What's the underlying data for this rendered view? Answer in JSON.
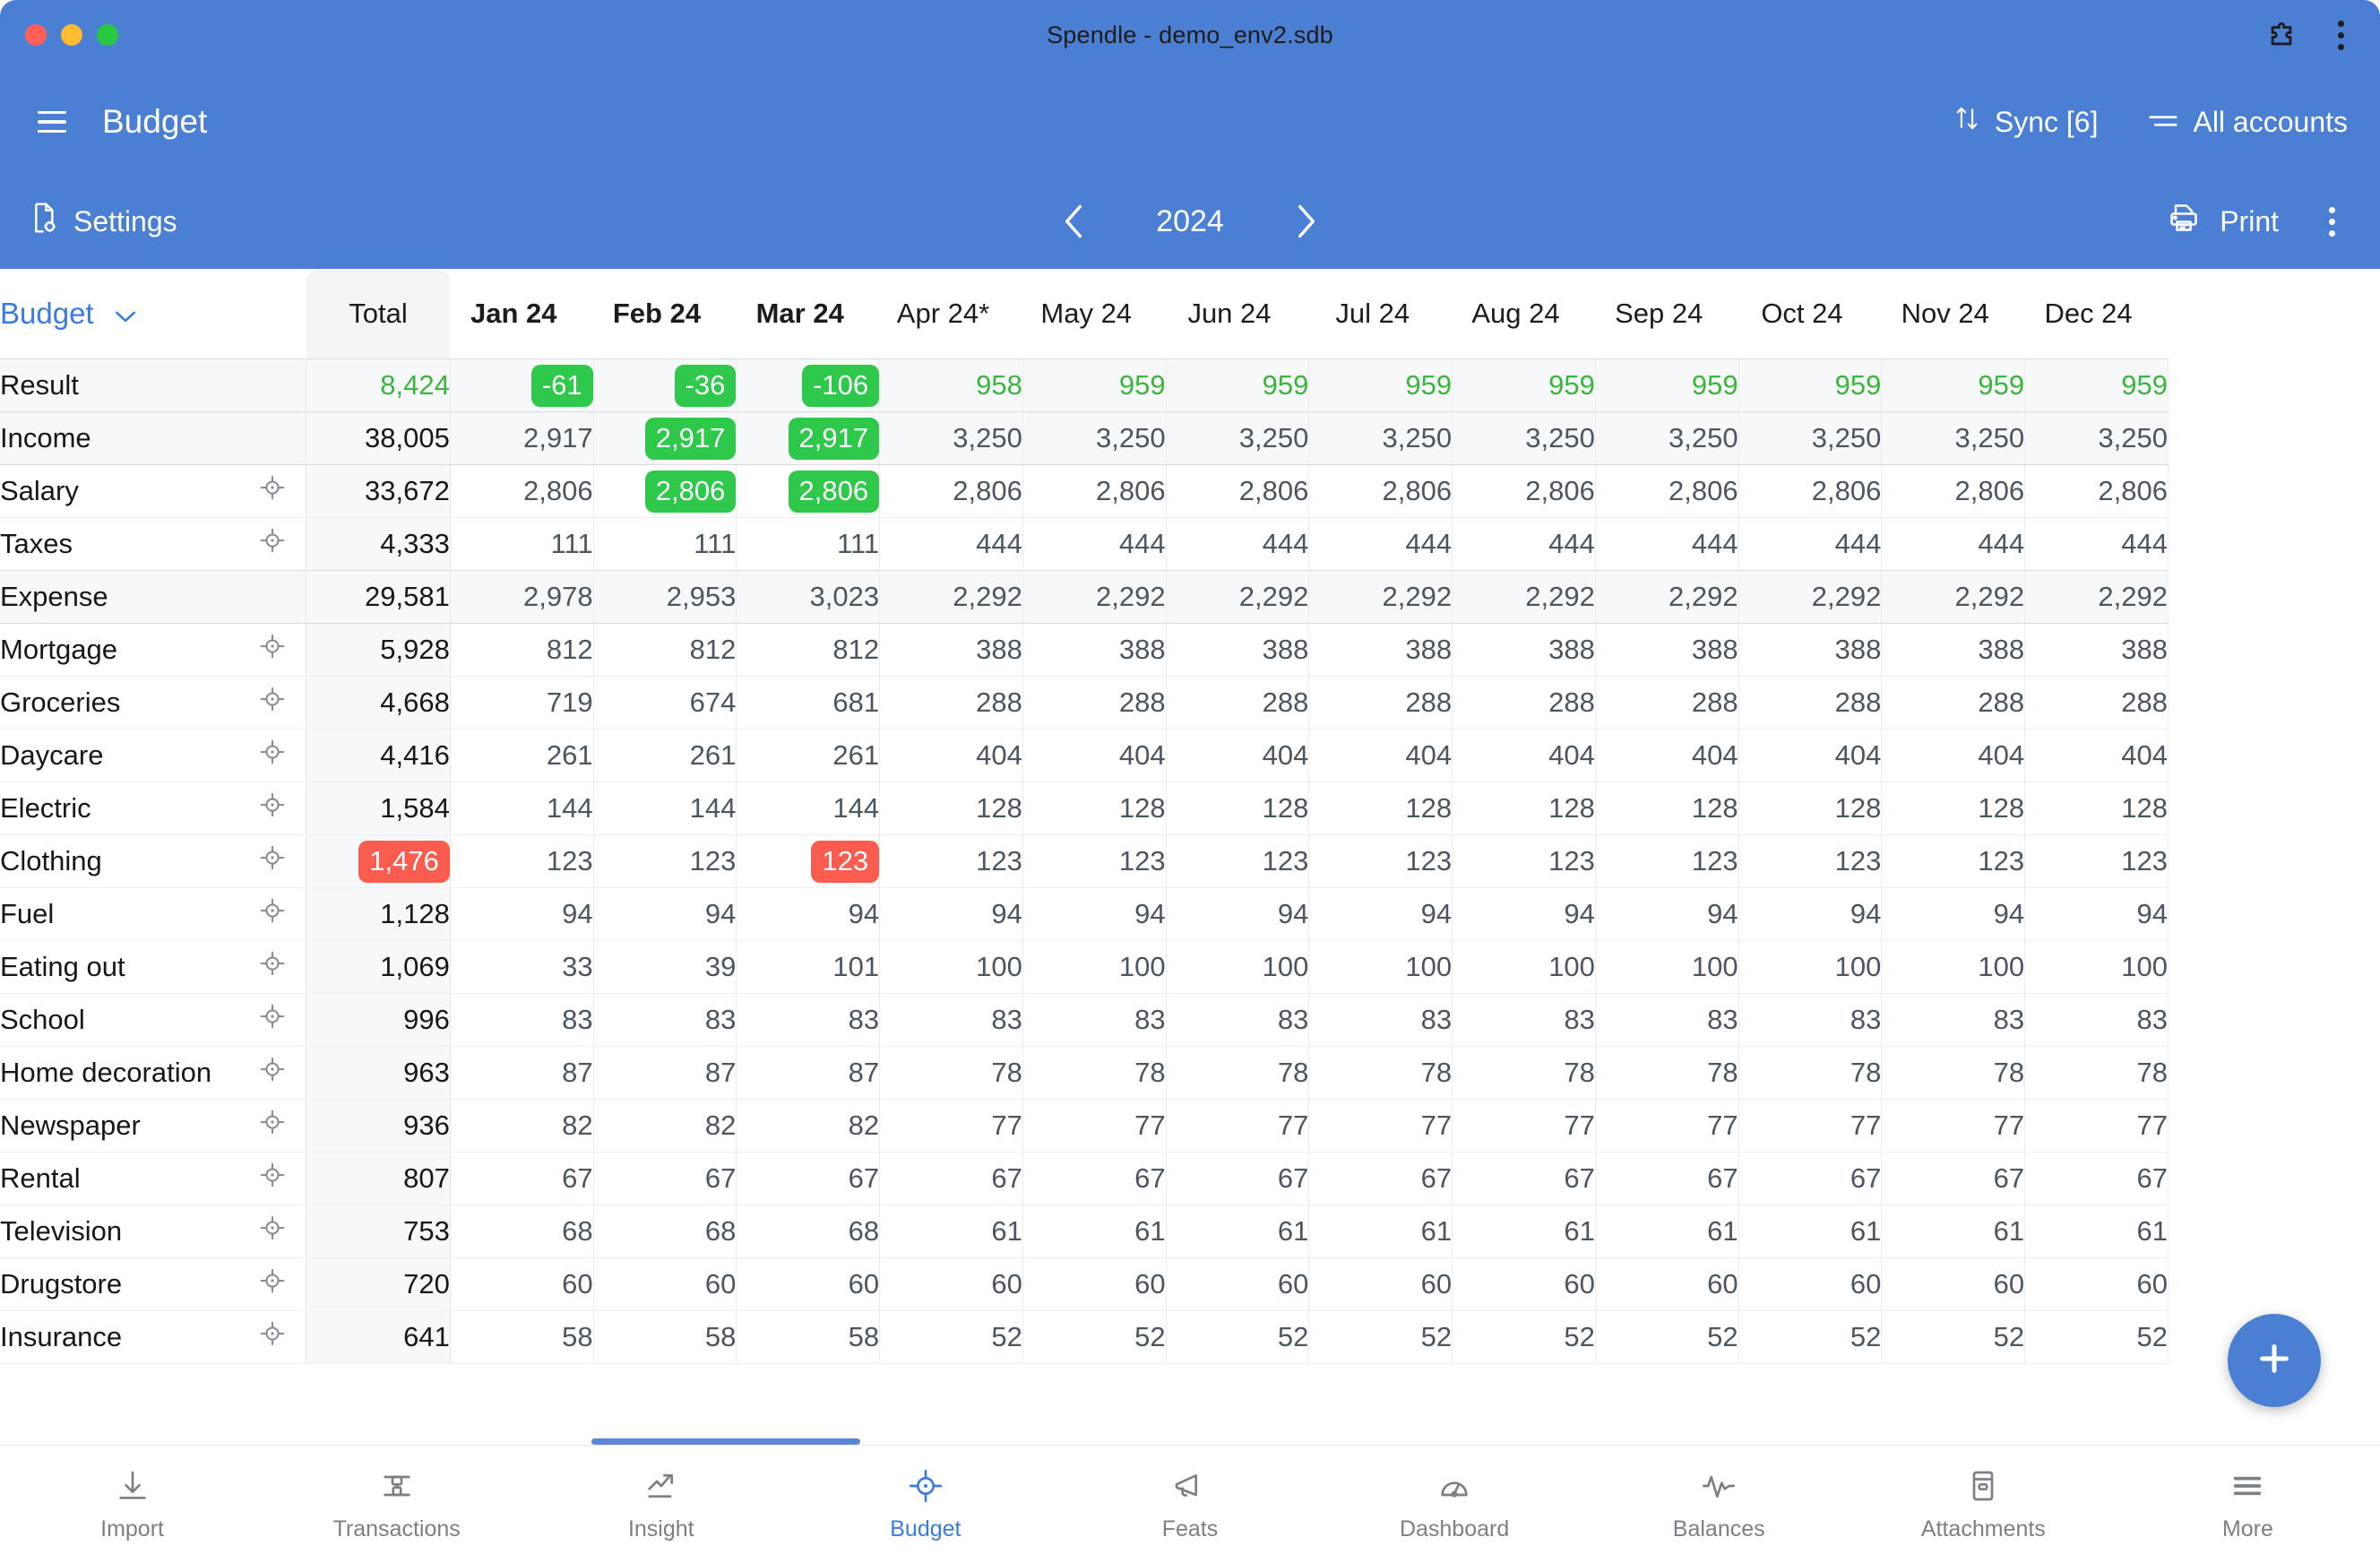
{
  "window": {
    "title": "Spendle - demo_env2.sdb",
    "traffic_lights": [
      "close",
      "minimize",
      "maximize"
    ],
    "extension_icon": "puzzle-piece-icon",
    "overflow_icon": "three-dot-menu-icon"
  },
  "navbar": {
    "menu_icon": "hamburger-icon",
    "title": "Budget",
    "sync_label": "Sync [6]",
    "sync_icon": "sync-arrows-icon",
    "accounts_label": "All accounts",
    "accounts_icon": "filter-list-icon"
  },
  "subbar": {
    "settings_label": "Settings",
    "settings_icon": "document-gear-icon",
    "prev_icon": "chevron-left-icon",
    "year": "2024",
    "next_icon": "chevron-right-icon",
    "print_label": "Print",
    "print_icon": "printer-icon",
    "more_icon": "three-dot-menu-icon"
  },
  "table": {
    "view_selector": "Budget",
    "view_selector_icon": "chevron-down-icon",
    "total_header": "Total",
    "months": [
      {
        "label": "Jan 24",
        "bold": true
      },
      {
        "label": "Feb 24",
        "bold": true
      },
      {
        "label": "Mar 24",
        "bold": true
      },
      {
        "label": "Apr 24*",
        "bold": false
      },
      {
        "label": "May 24",
        "bold": false
      },
      {
        "label": "Jun 24",
        "bold": false
      },
      {
        "label": "Jul 24",
        "bold": false
      },
      {
        "label": "Aug 24",
        "bold": false
      },
      {
        "label": "Sep 24",
        "bold": false
      },
      {
        "label": "Oct 24",
        "bold": false
      },
      {
        "label": "Nov 24",
        "bold": false
      },
      {
        "label": "Dec 24",
        "bold": false
      }
    ],
    "rows": [
      {
        "label": "Result",
        "type": "summary",
        "accent": "green",
        "target_icon": false,
        "total": "8,424",
        "cells": [
          {
            "v": "-61",
            "badge": "green"
          },
          {
            "v": "-36",
            "badge": "green"
          },
          {
            "v": "-106",
            "badge": "green"
          },
          {
            "v": "958"
          },
          {
            "v": "959"
          },
          {
            "v": "959"
          },
          {
            "v": "959"
          },
          {
            "v": "959"
          },
          {
            "v": "959"
          },
          {
            "v": "959"
          },
          {
            "v": "959"
          },
          {
            "v": "959"
          }
        ]
      },
      {
        "label": "Income",
        "type": "summary",
        "target_icon": false,
        "total": "38,005",
        "cells": [
          {
            "v": "2,917"
          },
          {
            "v": "2,917",
            "badge": "green"
          },
          {
            "v": "2,917",
            "badge": "green"
          },
          {
            "v": "3,250"
          },
          {
            "v": "3,250"
          },
          {
            "v": "3,250"
          },
          {
            "v": "3,250"
          },
          {
            "v": "3,250"
          },
          {
            "v": "3,250"
          },
          {
            "v": "3,250"
          },
          {
            "v": "3,250"
          },
          {
            "v": "3,250"
          }
        ]
      },
      {
        "label": "Salary",
        "type": "item",
        "target_icon": true,
        "total": "33,672",
        "cells": [
          {
            "v": "2,806"
          },
          {
            "v": "2,806",
            "badge": "green"
          },
          {
            "v": "2,806",
            "badge": "green"
          },
          {
            "v": "2,806"
          },
          {
            "v": "2,806"
          },
          {
            "v": "2,806"
          },
          {
            "v": "2,806"
          },
          {
            "v": "2,806"
          },
          {
            "v": "2,806"
          },
          {
            "v": "2,806"
          },
          {
            "v": "2,806"
          },
          {
            "v": "2,806"
          }
        ]
      },
      {
        "label": "Taxes",
        "type": "item",
        "target_icon": true,
        "total": "4,333",
        "cells": [
          {
            "v": "111"
          },
          {
            "v": "111"
          },
          {
            "v": "111"
          },
          {
            "v": "444"
          },
          {
            "v": "444"
          },
          {
            "v": "444"
          },
          {
            "v": "444"
          },
          {
            "v": "444"
          },
          {
            "v": "444"
          },
          {
            "v": "444"
          },
          {
            "v": "444"
          },
          {
            "v": "444"
          }
        ]
      },
      {
        "label": "Expense",
        "type": "summary",
        "target_icon": false,
        "total": "29,581",
        "cells": [
          {
            "v": "2,978"
          },
          {
            "v": "2,953"
          },
          {
            "v": "3,023"
          },
          {
            "v": "2,292"
          },
          {
            "v": "2,292"
          },
          {
            "v": "2,292"
          },
          {
            "v": "2,292"
          },
          {
            "v": "2,292"
          },
          {
            "v": "2,292"
          },
          {
            "v": "2,292"
          },
          {
            "v": "2,292"
          },
          {
            "v": "2,292"
          }
        ]
      },
      {
        "label": "Mortgage",
        "type": "item",
        "target_icon": true,
        "total": "5,928",
        "cells": [
          {
            "v": "812"
          },
          {
            "v": "812"
          },
          {
            "v": "812"
          },
          {
            "v": "388"
          },
          {
            "v": "388"
          },
          {
            "v": "388"
          },
          {
            "v": "388"
          },
          {
            "v": "388"
          },
          {
            "v": "388"
          },
          {
            "v": "388"
          },
          {
            "v": "388"
          },
          {
            "v": "388"
          }
        ]
      },
      {
        "label": "Groceries",
        "type": "item",
        "target_icon": true,
        "total": "4,668",
        "cells": [
          {
            "v": "719"
          },
          {
            "v": "674"
          },
          {
            "v": "681"
          },
          {
            "v": "288"
          },
          {
            "v": "288"
          },
          {
            "v": "288"
          },
          {
            "v": "288"
          },
          {
            "v": "288"
          },
          {
            "v": "288"
          },
          {
            "v": "288"
          },
          {
            "v": "288"
          },
          {
            "v": "288"
          }
        ]
      },
      {
        "label": "Daycare",
        "type": "item",
        "target_icon": true,
        "total": "4,416",
        "cells": [
          {
            "v": "261"
          },
          {
            "v": "261"
          },
          {
            "v": "261"
          },
          {
            "v": "404"
          },
          {
            "v": "404"
          },
          {
            "v": "404"
          },
          {
            "v": "404"
          },
          {
            "v": "404"
          },
          {
            "v": "404"
          },
          {
            "v": "404"
          },
          {
            "v": "404"
          },
          {
            "v": "404"
          }
        ]
      },
      {
        "label": "Electric",
        "type": "item",
        "target_icon": true,
        "total": "1,584",
        "cells": [
          {
            "v": "144"
          },
          {
            "v": "144"
          },
          {
            "v": "144"
          },
          {
            "v": "128"
          },
          {
            "v": "128"
          },
          {
            "v": "128"
          },
          {
            "v": "128"
          },
          {
            "v": "128"
          },
          {
            "v": "128"
          },
          {
            "v": "128"
          },
          {
            "v": "128"
          },
          {
            "v": "128"
          }
        ]
      },
      {
        "label": "Clothing",
        "type": "item",
        "target_icon": true,
        "total": "1,476",
        "total_badge": "red",
        "cells": [
          {
            "v": "123"
          },
          {
            "v": "123"
          },
          {
            "v": "123",
            "badge": "red"
          },
          {
            "v": "123"
          },
          {
            "v": "123"
          },
          {
            "v": "123"
          },
          {
            "v": "123"
          },
          {
            "v": "123"
          },
          {
            "v": "123"
          },
          {
            "v": "123"
          },
          {
            "v": "123"
          },
          {
            "v": "123"
          }
        ]
      },
      {
        "label": "Fuel",
        "type": "item",
        "target_icon": true,
        "total": "1,128",
        "cells": [
          {
            "v": "94"
          },
          {
            "v": "94"
          },
          {
            "v": "94"
          },
          {
            "v": "94"
          },
          {
            "v": "94"
          },
          {
            "v": "94"
          },
          {
            "v": "94"
          },
          {
            "v": "94"
          },
          {
            "v": "94"
          },
          {
            "v": "94"
          },
          {
            "v": "94"
          },
          {
            "v": "94"
          }
        ]
      },
      {
        "label": "Eating out",
        "type": "item",
        "target_icon": true,
        "total": "1,069",
        "cells": [
          {
            "v": "33"
          },
          {
            "v": "39"
          },
          {
            "v": "101"
          },
          {
            "v": "100"
          },
          {
            "v": "100"
          },
          {
            "v": "100"
          },
          {
            "v": "100"
          },
          {
            "v": "100"
          },
          {
            "v": "100"
          },
          {
            "v": "100"
          },
          {
            "v": "100"
          },
          {
            "v": "100"
          }
        ]
      },
      {
        "label": "School",
        "type": "item",
        "target_icon": true,
        "total": "996",
        "cells": [
          {
            "v": "83"
          },
          {
            "v": "83"
          },
          {
            "v": "83"
          },
          {
            "v": "83"
          },
          {
            "v": "83"
          },
          {
            "v": "83"
          },
          {
            "v": "83"
          },
          {
            "v": "83"
          },
          {
            "v": "83"
          },
          {
            "v": "83"
          },
          {
            "v": "83"
          },
          {
            "v": "83"
          }
        ]
      },
      {
        "label": "Home decoration",
        "type": "item",
        "target_icon": true,
        "total": "963",
        "cells": [
          {
            "v": "87"
          },
          {
            "v": "87"
          },
          {
            "v": "87"
          },
          {
            "v": "78"
          },
          {
            "v": "78"
          },
          {
            "v": "78"
          },
          {
            "v": "78"
          },
          {
            "v": "78"
          },
          {
            "v": "78"
          },
          {
            "v": "78"
          },
          {
            "v": "78"
          },
          {
            "v": "78"
          }
        ]
      },
      {
        "label": "Newspaper",
        "type": "item",
        "target_icon": true,
        "total": "936",
        "cells": [
          {
            "v": "82"
          },
          {
            "v": "82"
          },
          {
            "v": "82"
          },
          {
            "v": "77"
          },
          {
            "v": "77"
          },
          {
            "v": "77"
          },
          {
            "v": "77"
          },
          {
            "v": "77"
          },
          {
            "v": "77"
          },
          {
            "v": "77"
          },
          {
            "v": "77"
          },
          {
            "v": "77"
          }
        ]
      },
      {
        "label": "Rental",
        "type": "item",
        "target_icon": true,
        "total": "807",
        "cells": [
          {
            "v": "67"
          },
          {
            "v": "67"
          },
          {
            "v": "67"
          },
          {
            "v": "67"
          },
          {
            "v": "67"
          },
          {
            "v": "67"
          },
          {
            "v": "67"
          },
          {
            "v": "67"
          },
          {
            "v": "67"
          },
          {
            "v": "67"
          },
          {
            "v": "67"
          },
          {
            "v": "67"
          }
        ]
      },
      {
        "label": "Television",
        "type": "item",
        "target_icon": true,
        "total": "753",
        "cells": [
          {
            "v": "68"
          },
          {
            "v": "68"
          },
          {
            "v": "68"
          },
          {
            "v": "61"
          },
          {
            "v": "61"
          },
          {
            "v": "61"
          },
          {
            "v": "61"
          },
          {
            "v": "61"
          },
          {
            "v": "61"
          },
          {
            "v": "61"
          },
          {
            "v": "61"
          },
          {
            "v": "61"
          }
        ]
      },
      {
        "label": "Drugstore",
        "type": "item",
        "target_icon": true,
        "total": "720",
        "cells": [
          {
            "v": "60"
          },
          {
            "v": "60"
          },
          {
            "v": "60"
          },
          {
            "v": "60"
          },
          {
            "v": "60"
          },
          {
            "v": "60"
          },
          {
            "v": "60"
          },
          {
            "v": "60"
          },
          {
            "v": "60"
          },
          {
            "v": "60"
          },
          {
            "v": "60"
          },
          {
            "v": "60"
          }
        ]
      },
      {
        "label": "Insurance",
        "type": "item",
        "target_icon": true,
        "total": "641",
        "cells": [
          {
            "v": "58"
          },
          {
            "v": "58"
          },
          {
            "v": "58"
          },
          {
            "v": "52"
          },
          {
            "v": "52"
          },
          {
            "v": "52"
          },
          {
            "v": "52"
          },
          {
            "v": "52"
          },
          {
            "v": "52"
          },
          {
            "v": "52"
          },
          {
            "v": "52"
          },
          {
            "v": "52"
          }
        ]
      }
    ]
  },
  "fab": {
    "icon": "plus-icon"
  },
  "bottom_nav": {
    "items": [
      {
        "label": "Import",
        "icon": "download-arrow-icon",
        "active": false
      },
      {
        "label": "Transactions",
        "icon": "transactions-icon",
        "active": false
      },
      {
        "label": "Insight",
        "icon": "trend-chart-icon",
        "active": false
      },
      {
        "label": "Budget",
        "icon": "target-icon",
        "active": true
      },
      {
        "label": "Feats",
        "icon": "megaphone-icon",
        "active": false
      },
      {
        "label": "Dashboard",
        "icon": "gauge-icon",
        "active": false
      },
      {
        "label": "Balances",
        "icon": "pulse-icon",
        "active": false
      },
      {
        "label": "Attachments",
        "icon": "attachment-box-icon",
        "active": false
      },
      {
        "label": "More",
        "icon": "hamburger-icon",
        "active": false
      }
    ]
  },
  "colors": {
    "brand_blue": "#4a7fd4",
    "accent_blue": "#3b7ae0",
    "positive_green": "#2ec84a",
    "negative_red": "#fb5c50",
    "green_text": "#3cb53c"
  }
}
